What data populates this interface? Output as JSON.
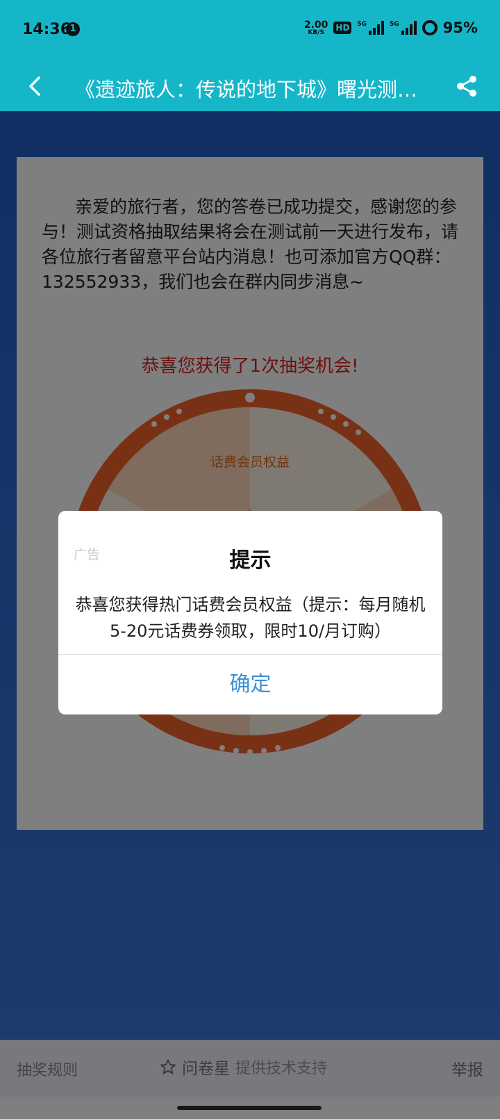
{
  "status_bar": {
    "time": "14:36",
    "notification_count": "1",
    "net_speed_value": "2.00",
    "net_speed_unit": "KB/S",
    "hd_label": "HD",
    "signal1_label": "5G",
    "signal2_label": "5G",
    "battery": "95%"
  },
  "nav": {
    "title": "《遗迹旅人：传说的地下城》曙光测试招募"
  },
  "card": {
    "notice": "亲爱的旅行者，您的答卷已成功提交，感谢您的参与！测试资格抽取结果将会在测试前一天进行发布，请各位旅行者留意平台站内消息！也可添加官方QQ群：132552933，我们也会在群内同步消息~",
    "lottery_congrats": "恭喜您获得了1次抽奖机会!",
    "wheel_prize_label": "话费会员权益"
  },
  "footer": {
    "rules_link": "抽奖规则",
    "brand_name": "问卷星",
    "tech_support": "提供技术支持",
    "report": "举报"
  },
  "dialog": {
    "ad_label": "广告",
    "title": "提示",
    "message": "恭喜您获得热门话费会员权益（提示：每月随机5-20元话费券领取，限时10/月订购）",
    "confirm_label": "确定"
  },
  "colors": {
    "header_bg": "#16b6c9",
    "confirm_text": "#3a90d8",
    "congrats_text": "#d92020",
    "wheel_rim": "#f3622a"
  }
}
